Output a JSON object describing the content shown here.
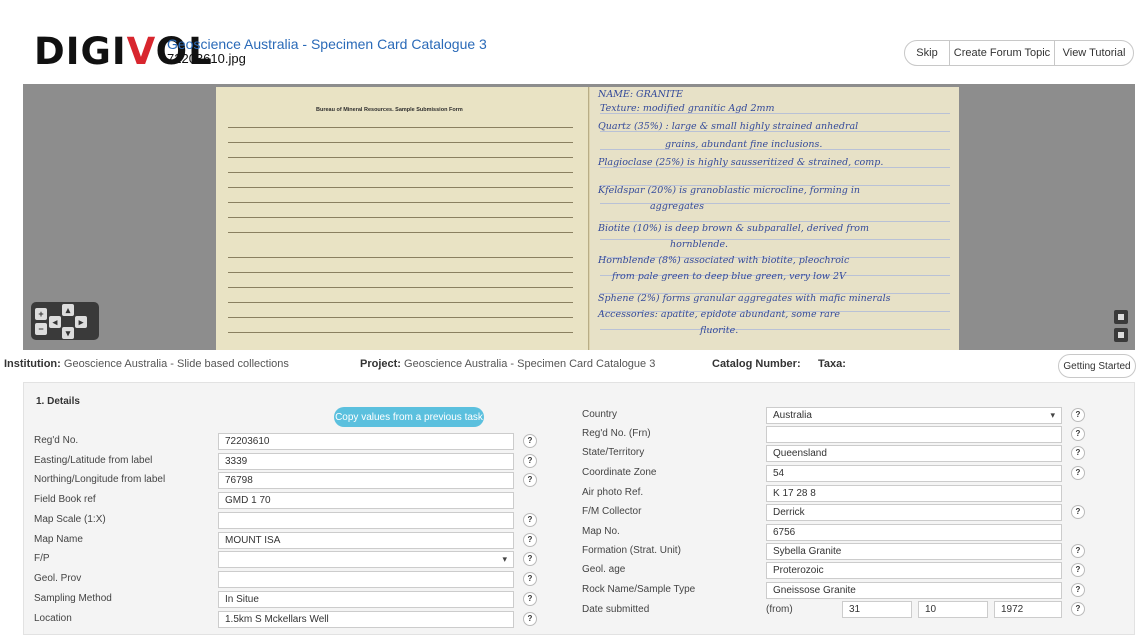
{
  "header": {
    "logo_main": "DIGI",
    "logo_v": "V",
    "logo_end": "OL",
    "title": "Geoscience Australia - Specimen Card Catalogue 3",
    "filename": "72203610.jpg",
    "buttons": {
      "skip": "Skip",
      "forum": "Create Forum Topic",
      "tutorial": "View Tutorial"
    }
  },
  "card": {
    "form_heading": "Bureau of Mineral Resources. Sample Submission Form",
    "notes": [
      "NAME:   GRANITE",
      "Texture:  modified granitic   Agd  2mm",
      "Quartz (35%) : large & small highly strained anhedral",
      "grains, abundant fine inclusions.",
      "Plagioclase (25%) is highly sausseritized & strained, comp.",
      "Kfeldspar (20%) is granoblastic microcline, forming in",
      "aggregates",
      "Biotite (10%) is deep brown & subparallel, derived from",
      "hornblende.",
      "Hornblende (8%) associated with biotite, pleochroic",
      "from pale green to deep blue green, very low 2V",
      "Sphene (2%) forms granular aggregates with mafic minerals",
      "Accessories: apatite, epidote abundant, some rare",
      "fluorite."
    ]
  },
  "info": {
    "institution_label": "Institution:",
    "institution": "Geoscience Australia - Slide based collections",
    "project_label": "Project:",
    "project": "Geoscience Australia - Specimen Card Catalogue 3",
    "catalog_label": "Catalog Number:",
    "taxa_label": "Taxa:",
    "getting_started": "Getting Started"
  },
  "details": {
    "section_title": "1. Details",
    "copy_button": "Copy values from a previous task",
    "help_glyph": "?",
    "left_fields": [
      {
        "label": "Reg'd No.",
        "value": "72203610"
      },
      {
        "label": "Easting/Latitude from label",
        "value": "3339"
      },
      {
        "label": "Northing/Longitude from label",
        "value": "76798"
      },
      {
        "label": "Field Book ref",
        "value": "GMD 1 70"
      },
      {
        "label": "Map Scale (1:X)",
        "value": ""
      },
      {
        "label": "Map Name",
        "value": "MOUNT ISA"
      },
      {
        "label": "F/P",
        "value": ""
      },
      {
        "label": "Geol. Prov",
        "value": ""
      },
      {
        "label": "Sampling Method",
        "value": "In Situe"
      },
      {
        "label": "Location",
        "value": "1.5km S Mckellars Well"
      }
    ],
    "right_fields": [
      {
        "label": "Country",
        "value": "Australia"
      },
      {
        "label": "Reg'd No. (Frn)",
        "value": ""
      },
      {
        "label": "State/Territory",
        "value": "Queensland"
      },
      {
        "label": "Coordinate Zone",
        "value": "54"
      },
      {
        "label": "Air photo Ref.",
        "value": "K 17 28 8"
      },
      {
        "label": "F/M Collector",
        "value": "Derrick"
      },
      {
        "label": "Map No.",
        "value": "6756"
      },
      {
        "label": "Formation (Strat. Unit)",
        "value": "Sybella Granite"
      },
      {
        "label": "Geol. age",
        "value": "Proterozoic"
      },
      {
        "label": "Rock Name/Sample Type",
        "value": "Gneissose Granite"
      },
      {
        "label": "Date submitted",
        "value": ""
      }
    ],
    "date": {
      "from_label": "(from)",
      "day": "31",
      "month": "10",
      "year": "1972"
    }
  }
}
